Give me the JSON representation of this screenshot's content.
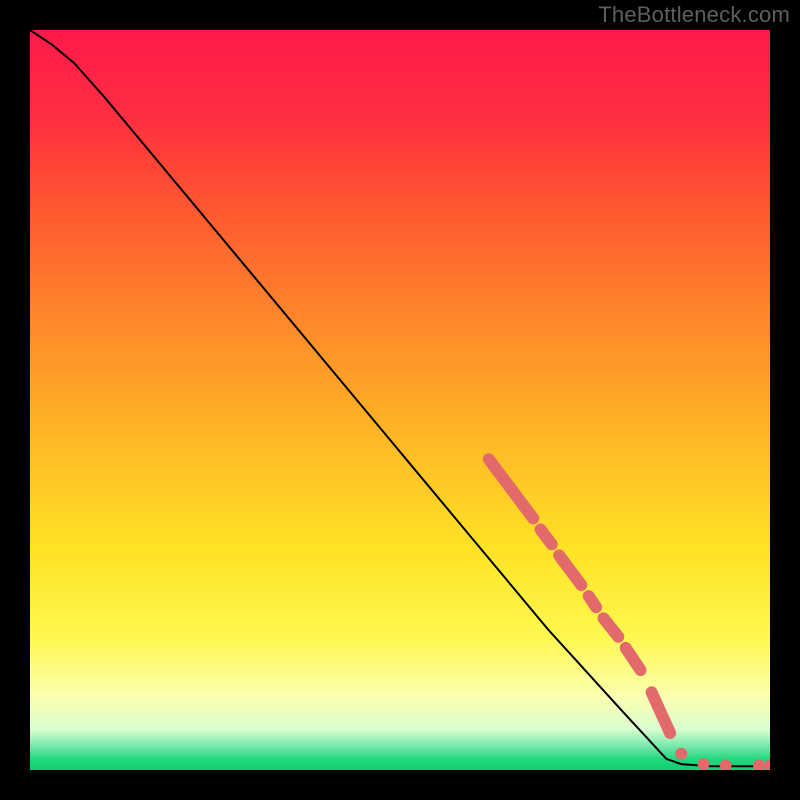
{
  "attribution": "TheBottleneck.com",
  "colors": {
    "background": "#000000",
    "gradient_stops": [
      {
        "offset": 0.0,
        "color": "#ff1a4b"
      },
      {
        "offset": 0.12,
        "color": "#ff2f3f"
      },
      {
        "offset": 0.25,
        "color": "#ff5a2f"
      },
      {
        "offset": 0.4,
        "color": "#ff8a2a"
      },
      {
        "offset": 0.55,
        "color": "#ffb726"
      },
      {
        "offset": 0.7,
        "color": "#ffe225"
      },
      {
        "offset": 0.82,
        "color": "#fff84f"
      },
      {
        "offset": 0.9,
        "color": "#fcffb0"
      },
      {
        "offset": 0.945,
        "color": "#d9ffd0"
      },
      {
        "offset": 0.97,
        "color": "#6fe6a8"
      },
      {
        "offset": 0.985,
        "color": "#23d87f"
      },
      {
        "offset": 1.0,
        "color": "#0fd071"
      }
    ],
    "curve": "#000000",
    "markers": "#e36a6a"
  },
  "chart_data": {
    "type": "line",
    "title": "",
    "xlabel": "",
    "ylabel": "",
    "xlim": [
      0,
      100
    ],
    "ylim": [
      0,
      100
    ],
    "curve": [
      {
        "x": 0,
        "y": 100
      },
      {
        "x": 3,
        "y": 98
      },
      {
        "x": 6,
        "y": 95.5
      },
      {
        "x": 10,
        "y": 91
      },
      {
        "x": 15,
        "y": 85
      },
      {
        "x": 20,
        "y": 79
      },
      {
        "x": 30,
        "y": 67
      },
      {
        "x": 40,
        "y": 55
      },
      {
        "x": 50,
        "y": 43
      },
      {
        "x": 60,
        "y": 31
      },
      {
        "x": 70,
        "y": 19
      },
      {
        "x": 80,
        "y": 8
      },
      {
        "x": 86,
        "y": 1.5
      },
      {
        "x": 88,
        "y": 0.8
      },
      {
        "x": 92,
        "y": 0.5
      },
      {
        "x": 96,
        "y": 0.5
      },
      {
        "x": 100,
        "y": 0.5
      }
    ],
    "marker_segments": [
      {
        "x1": 62,
        "y1": 42,
        "x2": 68,
        "y2": 34
      },
      {
        "x1": 69,
        "y1": 32.5,
        "x2": 70.5,
        "y2": 30.5
      },
      {
        "x1": 71.5,
        "y1": 29,
        "x2": 74.5,
        "y2": 25
      },
      {
        "x1": 75.5,
        "y1": 23.5,
        "x2": 76.5,
        "y2": 22
      },
      {
        "x1": 77.5,
        "y1": 20.5,
        "x2": 79.5,
        "y2": 18
      },
      {
        "x1": 80.5,
        "y1": 16.5,
        "x2": 82.5,
        "y2": 13.5
      },
      {
        "x1": 84,
        "y1": 10.5,
        "x2": 86.5,
        "y2": 5
      }
    ],
    "marker_dots": [
      {
        "x": 88,
        "y": 2.2
      },
      {
        "x": 91,
        "y": 0.8
      },
      {
        "x": 94,
        "y": 0.6
      },
      {
        "x": 98.5,
        "y": 0.6
      },
      {
        "x": 100,
        "y": 0.6
      }
    ]
  }
}
